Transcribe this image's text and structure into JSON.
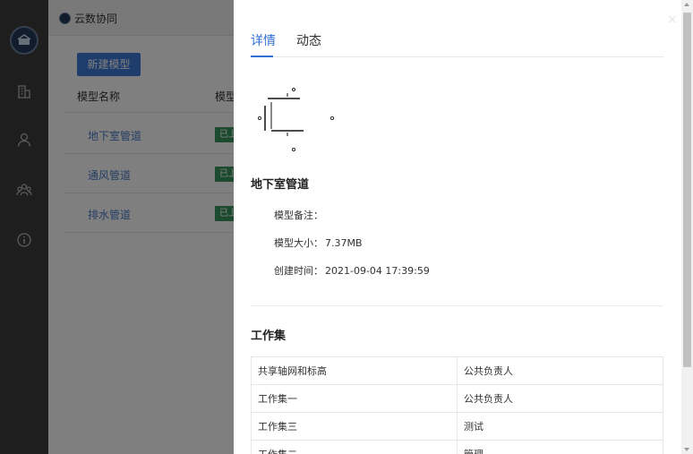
{
  "app": {
    "brand": "云数协同",
    "new_model_button": "新建模型",
    "columns": [
      "模型名称",
      "模型"
    ],
    "models": [
      {
        "name": "地下室管道",
        "badge": "已上"
      },
      {
        "name": "通风管道",
        "badge": "已上"
      },
      {
        "name": "排水管道",
        "badge": "已上"
      }
    ]
  },
  "sidebar": {
    "icons": [
      "building-icon",
      "user-icon",
      "team-icon",
      "info-icon"
    ]
  },
  "drawer": {
    "close": "×",
    "tabs": [
      {
        "label": "详情",
        "active": true
      },
      {
        "label": "动态",
        "active": false
      }
    ],
    "model_name": "地下室管道",
    "info": [
      {
        "label": "模型备注：",
        "value": ""
      },
      {
        "label": "模型大小：",
        "value": "7.37MB"
      },
      {
        "label": "创建时间：",
        "value": "2021-09-04 17:39:59"
      }
    ],
    "workset_title": "工作集",
    "worksets": [
      {
        "name": "共享轴网和标高",
        "owner": "公共负责人"
      },
      {
        "name": "工作集一",
        "owner": "公共负责人"
      },
      {
        "name": "工作集三",
        "owner": "测试"
      },
      {
        "name": "工作集二",
        "owner": "管理"
      }
    ]
  },
  "colors": {
    "accent": "#2f6fd1",
    "button": "#3f7bd9",
    "badge": "#39955e",
    "sidebar": "#3c3c3c"
  }
}
